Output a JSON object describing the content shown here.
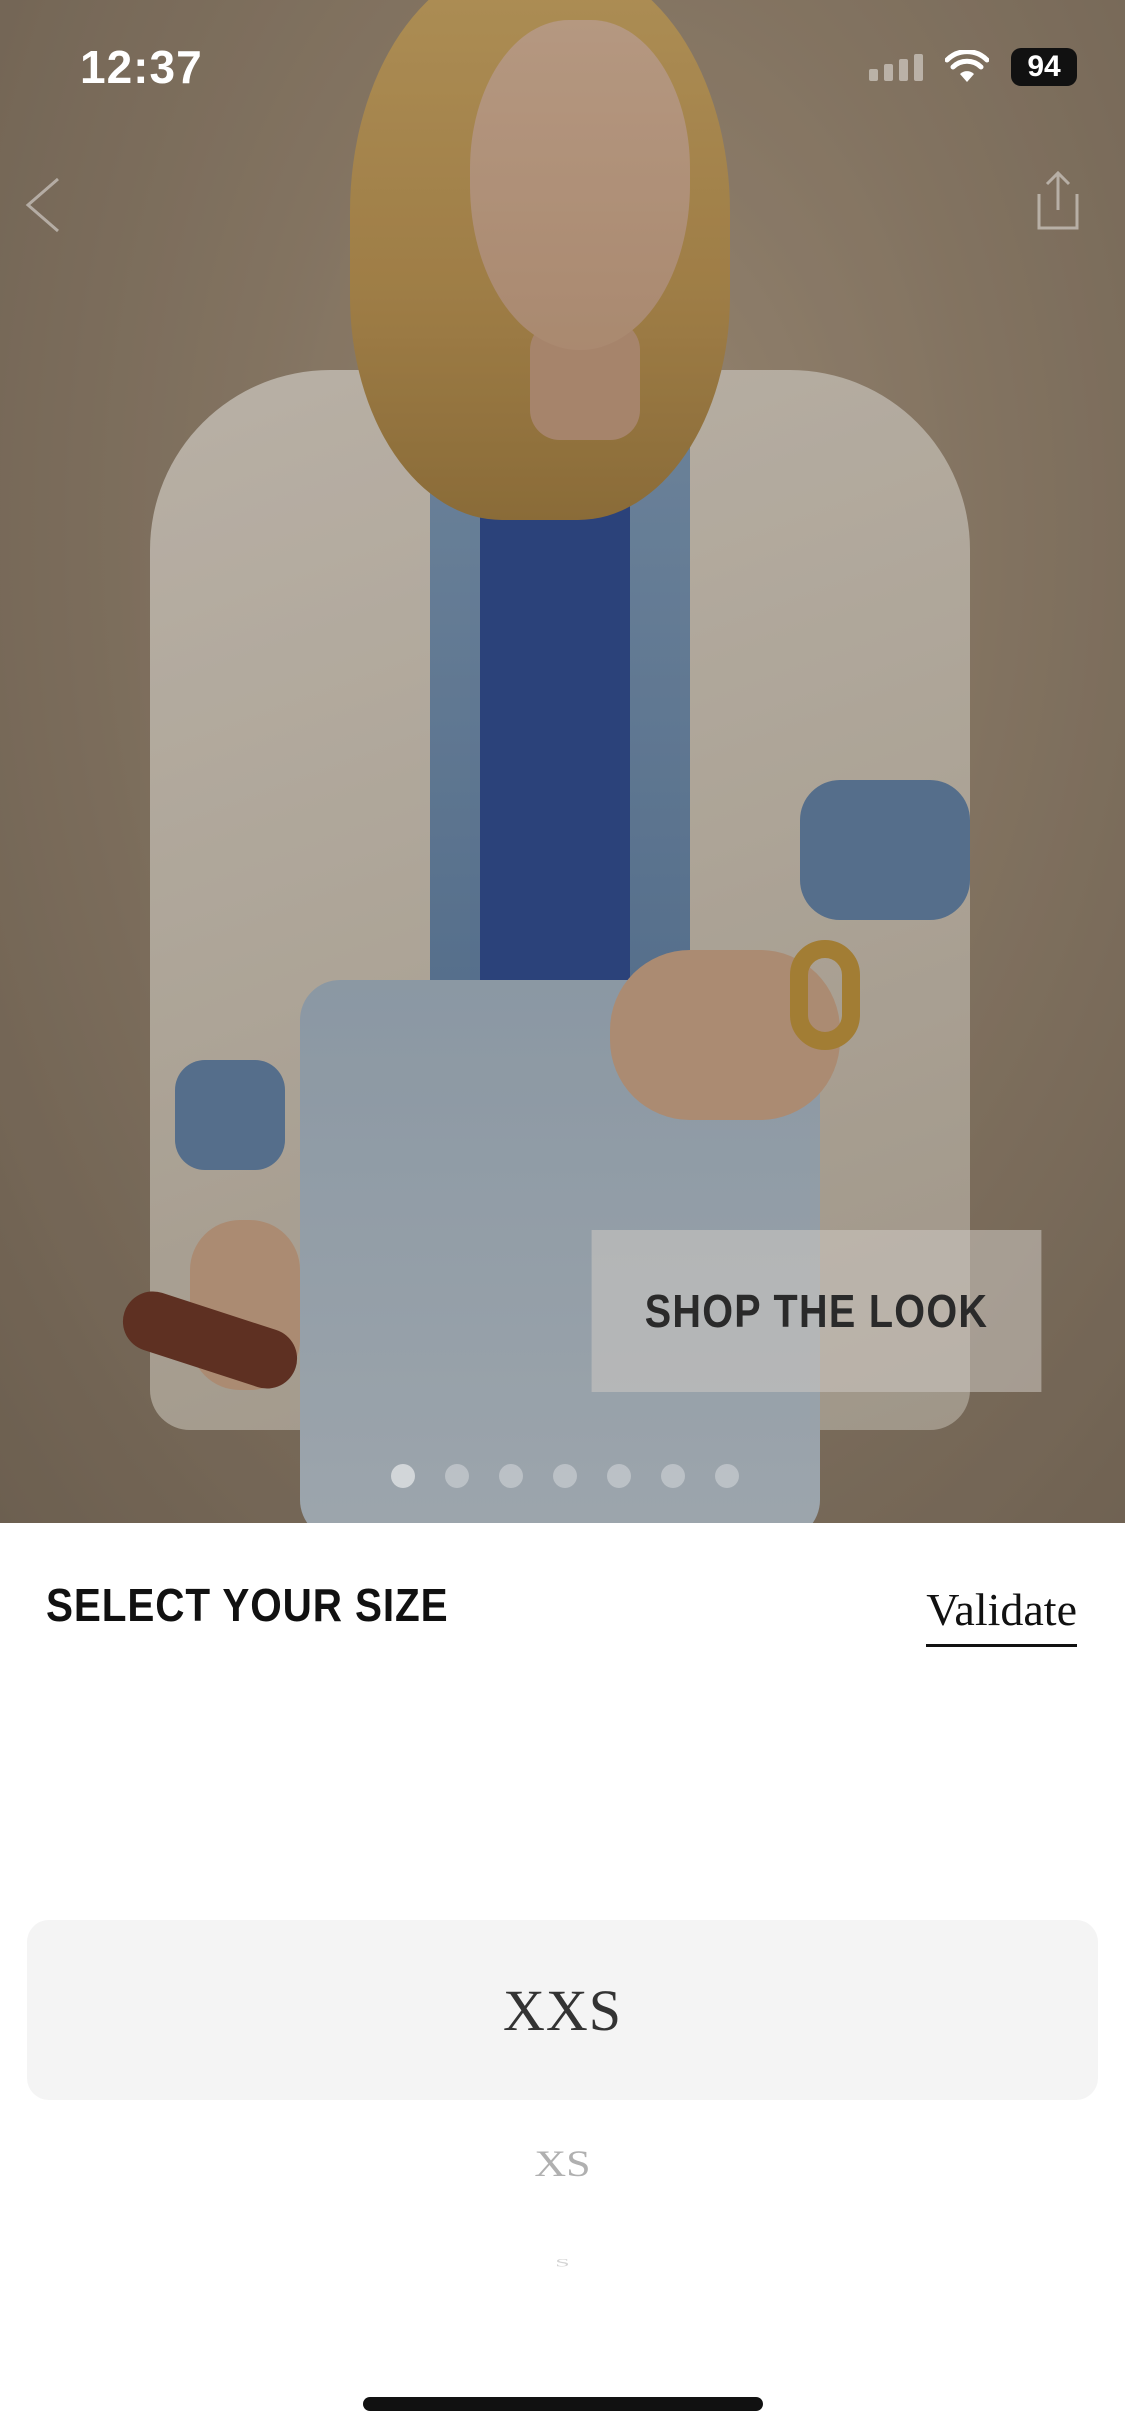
{
  "status_bar": {
    "time": "12:37",
    "battery": "94",
    "signal_icon": "cellular-signal-icon",
    "wifi_icon": "wifi-icon"
  },
  "nav": {
    "back_icon": "chevron-left-icon",
    "share_icon": "share-icon"
  },
  "hero": {
    "shop_the_look_label": "SHOP THE LOOK",
    "carousel": {
      "page_count": 7,
      "current_page": 1
    }
  },
  "size_sheet": {
    "title": "SELECT YOUR SIZE",
    "validate_label": "Validate",
    "options": [
      "XXS",
      "XS",
      "S"
    ],
    "selected": "XXS"
  },
  "colors": {
    "text_primary": "#111111",
    "picker_highlight": "#f4f4f4"
  }
}
